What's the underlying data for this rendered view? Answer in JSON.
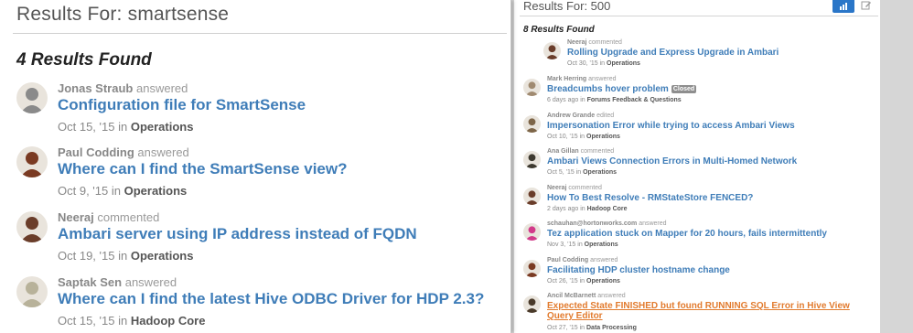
{
  "left": {
    "title": "Results For: smartsense",
    "count": "4 Results Found",
    "in_word": "in",
    "items": [
      {
        "author": "Jonas Straub",
        "action": "answered",
        "title": "Configuration file for SmartSense",
        "date": "Oct 15, '15",
        "space": "Operations",
        "avatar": "#8a8a8a"
      },
      {
        "author": "Paul Codding",
        "action": "answered",
        "title": "Where can I find the SmartSense view?",
        "date": "Oct 9, '15",
        "space": "Operations",
        "avatar": "#7a3a22"
      },
      {
        "author": "Neeraj",
        "action": "commented",
        "title": "Ambari server using IP address instead of FQDN",
        "date": "Oct 19, '15",
        "space": "Operations",
        "avatar": "#6a3d2a"
      },
      {
        "author": "Saptak Sen",
        "action": "answered",
        "title": "Where can I find the latest Hive ODBC Driver for HDP 2.3?",
        "date": "Oct 15, '15",
        "space": "Hadoop Core",
        "avatar": "#b8b29a"
      }
    ]
  },
  "right": {
    "title": "Results For: 500",
    "count": "8 Results Found",
    "in_word": "in",
    "items": [
      {
        "author": "Neeraj",
        "action": "commented",
        "title": "Rolling Upgrade and Express Upgrade in Ambari",
        "date": "Oct 30, '15",
        "space": "Operations",
        "badge": "",
        "avatar": "#6a3d2a"
      },
      {
        "author": "Mark Herring",
        "action": "answered",
        "title": "Breadcumbs hover problem",
        "date": "6 days ago",
        "space": "Forums Feedback & Questions",
        "badge": "Closed",
        "avatar": "#a08a70"
      },
      {
        "author": "Andrew Grande",
        "action": "edited",
        "title": "Impersonation Error while trying to access Ambari Views",
        "date": "Oct 10, '15",
        "space": "Operations",
        "badge": "",
        "avatar": "#7d6548"
      },
      {
        "author": "Ana Gillan",
        "action": "commented",
        "title": "Ambari Views Connection Errors in Multi-Homed Network",
        "date": "Oct 5, '15",
        "space": "Operations",
        "badge": "",
        "avatar": "#3e3a30"
      },
      {
        "author": "Neeraj",
        "action": "commented",
        "title": "How To Best Resolve - RMStateStore FENCED?",
        "date": "2 days ago",
        "space": "Hadoop Core",
        "badge": "",
        "avatar": "#6a3d2a"
      },
      {
        "author": "schauhan@hortonworks.com",
        "action": "answered",
        "title": "Tez application stuck on Mapper for 20 hours, fails intermittently",
        "date": "Nov 3, '15",
        "space": "Operations",
        "badge": "",
        "avatar": "#d23a8a"
      },
      {
        "author": "Paul Codding",
        "action": "answered",
        "title": "Facilitating HDP cluster hostname change",
        "date": "Oct 26, '15",
        "space": "Operations",
        "badge": "",
        "avatar": "#7a3a22"
      },
      {
        "author": "Ancil McBarnett",
        "action": "answered",
        "title": "Expected State FINISHED but found RUNNING SQL Error in Hive View Query Editor",
        "date": "Oct 27, '15",
        "space": "Data Processing",
        "badge": "",
        "avatar": "#4a3a2a",
        "highlight": true
      }
    ]
  },
  "colors": {
    "link": "#3f7db8",
    "highlight_link": "#e27b2e",
    "button": "#2a76c8"
  },
  "icons": {
    "chart": "bar-chart-icon",
    "edit": "edit-icon"
  }
}
